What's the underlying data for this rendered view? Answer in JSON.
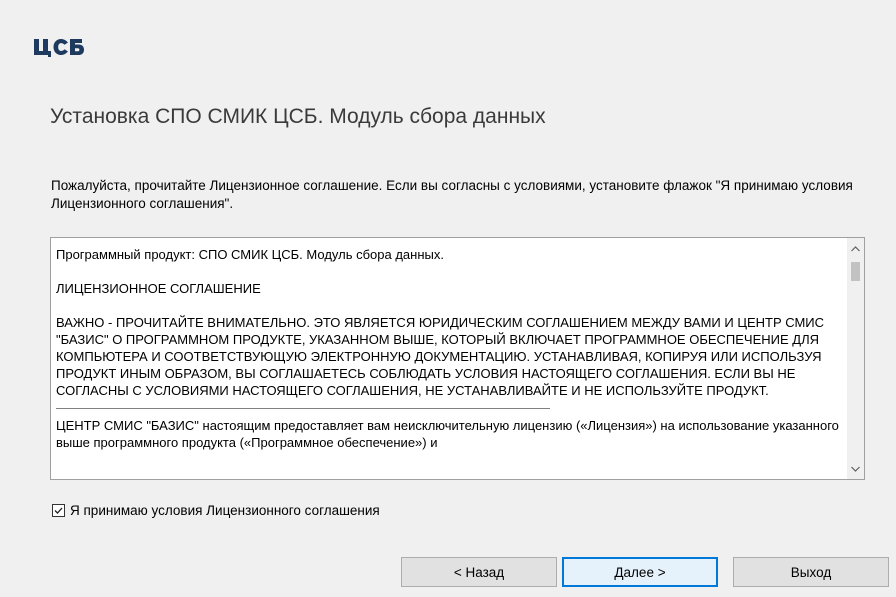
{
  "logo": {
    "text": "ЦСБ",
    "icon": "logo"
  },
  "title": "Установка СПО СМИК ЦСБ. Модуль сбора данных",
  "intro": "Пожалуйста, прочитайте Лицензионное соглашение. Если вы согласны с условиями, установите флажок \"Я принимаю условия Лицензионного соглашения\".",
  "license": {
    "product_line": "Программный продукт: СПО СМИК ЦСБ. Модуль сбора данных.",
    "heading": "ЛИЦЕНЗИОННОЕ СОГЛАШЕНИЕ",
    "important": "ВАЖНО - ПРОЧИТАЙТЕ ВНИМАТЕЛЬНО. ЭТО ЯВЛЯЕТСЯ ЮРИДИЧЕСКИМ СОГЛАШЕНИЕМ МЕЖДУ ВАМИ И ЦЕНТР СМИС \"БАЗИС\" О ПРОГРАММНОМ ПРОДУКТЕ, УКАЗАННОМ ВЫШЕ, КОТОРЫЙ ВКЛЮЧАЕТ ПРОГРАММНОЕ ОБЕСПЕЧЕНИЕ ДЛЯ КОМПЬЮТЕРА И СООТВЕТСТВУЮЩУЮ ЭЛЕКТРОННУЮ ДОКУМЕНТАЦИЮ. УСТАНАВЛИВАЯ, КОПИРУЯ ИЛИ ИСПОЛЬЗУЯ ПРОДУКТ ИНЫМ ОБРАЗОМ, ВЫ СОГЛАШАЕТЕСЬ СОБЛЮДАТЬ УСЛОВИЯ НАСТОЯЩЕГО СОГЛАШЕНИЯ. ЕСЛИ ВЫ НЕ СОГЛАСНЫ С УСЛОВИЯМИ НАСТОЯЩЕГО СОГЛАШЕНИЯ, НЕ УСТАНАВЛИВАЙТЕ И НЕ ИСПОЛЬЗУЙТЕ ПРОДУКТ.",
    "grant": "ЦЕНТР СМИС \"БАЗИС\" настоящим предоставляет вам неисключительную лицензию («Лицензия») на использование указанного выше программного продукта («Программное обеспечение») и"
  },
  "accept_label": "Я принимаю условия Лицензионного соглашения",
  "accept_checked": true,
  "buttons": {
    "back": "< Назад",
    "next": "Далее >",
    "exit": "Выход"
  },
  "colors": {
    "background": "#f0f0f0",
    "focus": "#0078d7",
    "title": "#3a3a3a"
  }
}
